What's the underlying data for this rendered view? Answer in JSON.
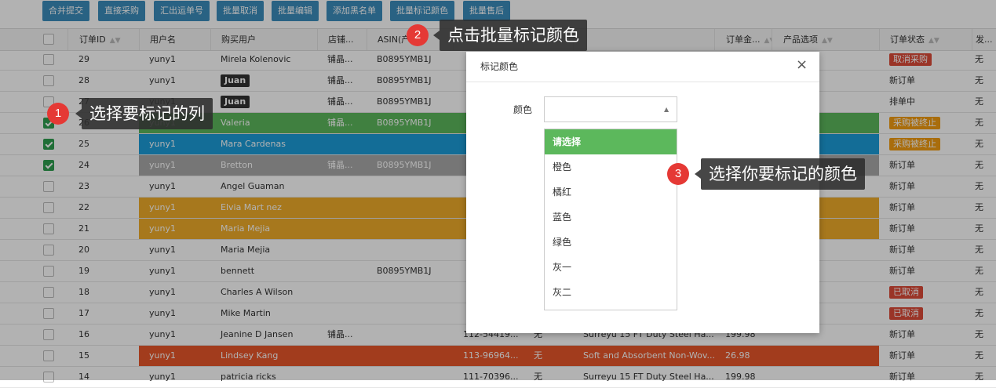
{
  "toolbar": {
    "buttons": [
      "合并提交",
      "直接采购",
      "汇出运单号",
      "批量取消",
      "批量编辑",
      "添加黑名单",
      "批量标记颜色",
      "批量售后"
    ]
  },
  "table": {
    "headers": [
      "",
      "订单ID",
      "用户名",
      "购买用户",
      "店铺...",
      "ASIN(产",
      "",
      "",
      "",
      "订单金...",
      "产品选项",
      "",
      "订单状态",
      "发..."
    ],
    "rows": [
      {
        "id": "29",
        "user": "yuny1",
        "buyer": "Mirela Kolenovic",
        "shop": "铺晶...",
        "asin": "B0895YMB1J",
        "status": "取消采购",
        "status_type": "red",
        "ship": "无",
        "checked": false,
        "color": ""
      },
      {
        "id": "28",
        "user": "yuny1",
        "buyer": "Juan",
        "buyer_tag": true,
        "shop": "铺晶...",
        "asin": "B0895YMB1J",
        "status": "新订单",
        "status_type": "",
        "ship": "无",
        "checked": false,
        "color": ""
      },
      {
        "id": "27",
        "user": "yuny1",
        "buyer": "Juan",
        "buyer_tag": true,
        "shop": "铺晶...",
        "asin": "B0895YMB1J",
        "status": "排单中",
        "status_type": "",
        "ship": "无",
        "checked": false,
        "color": ""
      },
      {
        "id": "26",
        "user": "yuny1",
        "buyer": "Valeria",
        "shop": "铺晶...",
        "asin": "B0895YMB1J",
        "status": "采购被终止",
        "status_type": "orange",
        "ship": "无",
        "checked": true,
        "color": "#5cb85c"
      },
      {
        "id": "25",
        "user": "yuny1",
        "buyer": "Mara Cardenas",
        "shop": "",
        "asin": "",
        "status": "采购被终止",
        "status_type": "orange",
        "ship": "无",
        "checked": true,
        "color": "#1c9dd9"
      },
      {
        "id": "24",
        "user": "yuny1",
        "buyer": "Bretton",
        "shop": "铺晶...",
        "asin": "B0895YMB1J",
        "status": "新订单",
        "status_type": "",
        "ship": "无",
        "checked": true,
        "color": "#aaaaaa"
      },
      {
        "id": "23",
        "user": "yuny1",
        "buyer": "Angel Guaman",
        "shop": "",
        "asin": "",
        "status": "新订单",
        "status_type": "",
        "ship": "无",
        "checked": false,
        "color": ""
      },
      {
        "id": "22",
        "user": "yuny1",
        "buyer": "Elvia Mart nez",
        "shop": "",
        "asin": "",
        "status": "新订单",
        "status_type": "",
        "ship": "无",
        "checked": false,
        "color": "#f0ad2a"
      },
      {
        "id": "21",
        "user": "yuny1",
        "buyer": "Maria Mejia",
        "shop": "",
        "asin": "",
        "status": "新订单",
        "status_type": "",
        "ship": "无",
        "checked": false,
        "color": "#f0ad2a"
      },
      {
        "id": "20",
        "user": "yuny1",
        "buyer": "Maria Mejia",
        "shop": "",
        "asin": "",
        "status": "新订单",
        "status_type": "",
        "ship": "无",
        "checked": false,
        "color": ""
      },
      {
        "id": "19",
        "user": "yuny1",
        "buyer": "bennett",
        "shop": "",
        "asin": "B0895YMB1J",
        "status": "新订单",
        "status_type": "",
        "ship": "无",
        "checked": false,
        "color": ""
      },
      {
        "id": "18",
        "user": "yuny1",
        "buyer": "Charles A Wilson",
        "shop": "",
        "asin": "",
        "status": "已取消",
        "status_type": "red",
        "ship": "无",
        "checked": false,
        "color": ""
      },
      {
        "id": "17",
        "user": "yuny1",
        "buyer": "Mike Martin",
        "shop": "",
        "asin": "",
        "status": "已取消",
        "status_type": "red",
        "ship": "无",
        "checked": false,
        "color": ""
      },
      {
        "id": "16",
        "user": "yuny1",
        "buyer": "Jeanine D Jansen",
        "shop": "铺晶...",
        "asin": "",
        "order_no": "112-54419...",
        "col7": "无",
        "product": "Surreyu 15 FT Duty Steel Ha...",
        "amount": "199.98",
        "status": "新订单",
        "status_type": "",
        "ship": "无",
        "checked": false,
        "color": ""
      },
      {
        "id": "15",
        "user": "yuny1",
        "buyer": "Lindsey Kang",
        "shop": "",
        "asin": "",
        "order_no": "113-96964...",
        "col7": "无",
        "product": "Soft and Absorbent Non-Wov...",
        "amount": "26.98",
        "status": "新订单",
        "status_type": "",
        "ship": "无",
        "checked": false,
        "color": "#e8562a"
      },
      {
        "id": "14",
        "user": "yuny1",
        "buyer": "patricia ricks",
        "shop": "",
        "asin": "",
        "order_no": "111-70396...",
        "col7": "无",
        "product": "Surreyu 15 FT Duty Steel Ha...",
        "amount": "199.98",
        "status": "新订单",
        "status_type": "",
        "ship": "无",
        "checked": false,
        "color": ""
      }
    ]
  },
  "modal": {
    "title": "标记颜色",
    "close": "×",
    "field_label": "颜色",
    "options": [
      "请选择",
      "橙色",
      "橘红",
      "蓝色",
      "绿色",
      "灰一",
      "灰二"
    ]
  },
  "callouts": [
    {
      "num": "1",
      "text": "选择要标记的列"
    },
    {
      "num": "2",
      "text": "点击批量标记颜色"
    },
    {
      "num": "3",
      "text": "选择你要标记的颜色"
    }
  ]
}
